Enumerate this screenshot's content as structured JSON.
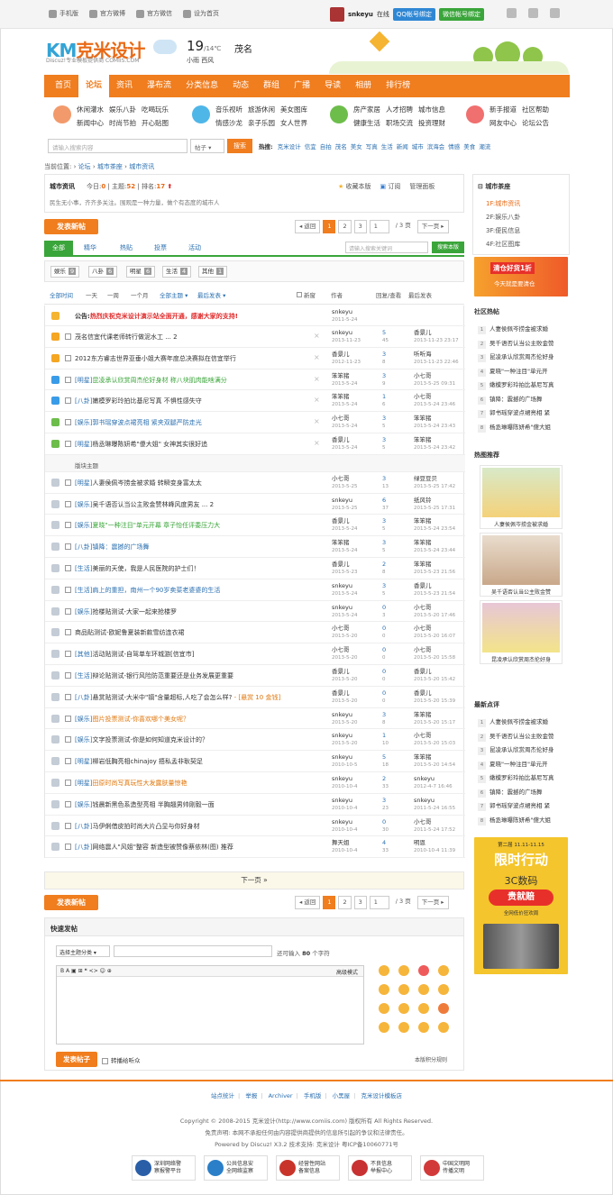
{
  "topbar": {
    "links": [
      "手机版",
      "官方微博",
      "官方微信",
      "设为首页"
    ],
    "username": "snkeyu",
    "status": "在线",
    "qq_bind": "QQ帐号绑定",
    "wx_bind": "微信帐号绑定"
  },
  "header": {
    "logo_text": "克米设计",
    "logo_prefix": "KM",
    "logo_sub": "Discuz!专业模板提供商",
    "logo_domain": "COMIIS.COM",
    "temp": "19",
    "temp_range": "/14℃",
    "city": "茂名",
    "weather_desc": "小雨 西风"
  },
  "nav": [
    "首页",
    "论坛",
    "资讯",
    "瀑布流",
    "分类信息",
    "动态",
    "群组",
    "广播",
    "导读",
    "相册",
    "排行榜"
  ],
  "nav_active": "论坛",
  "quick": [
    {
      "links": [
        "休闲灌水",
        "娱乐八卦",
        "吃喝玩乐",
        "新闻中心",
        "时尚节拍",
        "开心贴图"
      ],
      "color": "#f29a6b"
    },
    {
      "links": [
        "音乐视听",
        "旅游休闲",
        "美女图库",
        "情感沙龙",
        "亲子乐园",
        "女人世界"
      ],
      "color": "#4fb6e8"
    },
    {
      "links": [
        "房产家居",
        "人才招聘",
        "城市信息",
        "健康生活",
        "职场交流",
        "投资理财"
      ],
      "color": "#6dbd4b"
    },
    {
      "links": [
        "新手报道",
        "社区帮助",
        "网友中心",
        "论坛公告"
      ],
      "color": "#f06f6f"
    }
  ],
  "search": {
    "placeholder": "请输入搜索内容",
    "type": "帖子",
    "button": "搜索",
    "hot_label": "热搜:",
    "hot": [
      "克米设计",
      "信宜",
      "自拍",
      "茂名",
      "美女",
      "写真",
      "生活",
      "新闻",
      "城市",
      "滨海会",
      "情感",
      "美食",
      "潮流"
    ]
  },
  "breadcrumb": {
    "prefix": "当前位置:",
    "items": [
      "论坛",
      "城市茶座",
      "城市资讯"
    ],
    "sep": "›"
  },
  "forum": {
    "name": "城市资讯",
    "today_label": "今日:",
    "today": "0",
    "topics_label": "主题:",
    "topics": "52",
    "rank_label": "排名:",
    "rank": "17",
    "desc": "民生无小事，齐齐多关注。围观是一种力量，做个有态度的城市人",
    "fav": "收藏本版",
    "sub": "订阅",
    "manage": "管理面板"
  },
  "post_button": "发表新帖",
  "pager": {
    "back": "返回",
    "pages": [
      "1",
      "2",
      "3"
    ],
    "current": "1",
    "total": "/ 3 页",
    "next": "下一页"
  },
  "tabs": [
    "全部",
    "精华",
    "热贴",
    "投票",
    "活动"
  ],
  "tab_search": {
    "placeholder": "请输入搜索关键词",
    "button": "搜索本版"
  },
  "types": [
    {
      "name": "娱乐",
      "count": "9"
    },
    {
      "name": "八卦",
      "count": "6"
    },
    {
      "name": "明星",
      "count": "6"
    },
    {
      "name": "生活",
      "count": "4"
    },
    {
      "name": "其他",
      "count": "1"
    }
  ],
  "filter": {
    "items": [
      "全部时间",
      "一天",
      "一周",
      "一个月",
      "全部主题",
      "最后发表"
    ],
    "newwin": "新窗",
    "author": "作者",
    "replies": "回复/查看",
    "last": "最后发表"
  },
  "announcement": {
    "label": "公告:",
    "text": "热烈庆祝克米设计演示站全面开通，感谢大家的支持!",
    "author": "snkeyu",
    "date": "2011-5-24"
  },
  "sticky": [
    {
      "type": "",
      "title": "茂名信宜代课老师转行做泥水工",
      "suffix": " ... 2",
      "style": "",
      "author": "snkeyu",
      "date": "2013-11-23",
      "r": "5",
      "v": "45",
      "lu": "香景儿",
      "ld": "2013-11-23 23:17"
    },
    {
      "type": "",
      "title": "2012东方睿志世界亚垂小姐大赛年度总决赛拟在信宜举行",
      "suffix": "",
      "style": "",
      "author": "香景儿",
      "date": "2012-11-23",
      "r": "3",
      "v": "8",
      "lu": "听听海",
      "ld": "2013-11-23 22:46"
    },
    {
      "type": "[明星]",
      "title": "昆凌承认欣赏周杰伦好身材 称八块肌肉能啥满分",
      "suffix": "",
      "style": "green",
      "author": "笨笨猪",
      "date": "2013-5-24",
      "r": "3",
      "v": "9",
      "lu": "小七哥",
      "ld": "2013-5-25 09:31"
    },
    {
      "type": "[八卦]",
      "title": "嫩模罗彩玲拍比基尼写真 不惧性感失守",
      "suffix": "",
      "style": "",
      "author": "笨笨猪",
      "date": "2013-5-24",
      "r": "1",
      "v": "6",
      "lu": "小七哥",
      "ld": "2013-5-24 23:46"
    },
    {
      "type": "[娱乐]",
      "title": "郭书瑶穿波点裙亮相 紧夹双腿严防走光",
      "suffix": "",
      "style": "blue",
      "author": "小七哥",
      "date": "2013-5-24",
      "r": "3",
      "v": "5",
      "lu": "笨笨猪",
      "ld": "2013-5-24 23:43"
    },
    {
      "type": "[明星]",
      "title": "杨丞琳曝陈妍希\"傻大姐\" 女神其实很好追",
      "suffix": "",
      "style": "",
      "author": "香景儿",
      "date": "2013-5-24",
      "r": "3",
      "v": "5",
      "lu": "笨笨猪",
      "ld": "2013-5-24 23:42"
    }
  ],
  "section_label": "版块主题",
  "threads": [
    {
      "type": "[明星]",
      "title": "人妻侯佩岑捞金被求婚 转瞬变身富太太",
      "suffix": "",
      "style": "",
      "author": "小七哥",
      "date": "2013-5-25",
      "r": "3",
      "v": "13",
      "lu": "绿豆豆贝",
      "ld": "2013-5-25 17:42"
    },
    {
      "type": "[娱乐]",
      "title": "吴千语否认当公主败金赞林峰风度男友",
      "suffix": " ... 2",
      "style": "",
      "author": "snkeyu",
      "date": "2013-5-25",
      "r": "6",
      "v": "37",
      "lu": "纸风铃",
      "ld": "2013-5-25 17:31"
    },
    {
      "type": "[娱乐]",
      "title": "夏晓\"一种注目\"单元开幕 章子怡任评委压力大",
      "suffix": "",
      "style": "green",
      "author": "香景儿",
      "date": "2013-5-24",
      "r": "3",
      "v": "5",
      "lu": "笨笨猪",
      "ld": "2013-5-24 23:54"
    },
    {
      "type": "[八卦]",
      "title": "镇降：震撼的广场舞",
      "suffix": "",
      "style": "blue",
      "author": "笨笨猪",
      "date": "2013-5-24",
      "r": "3",
      "v": "5",
      "lu": "笨笨猪",
      "ld": "2013-5-24 23:44"
    },
    {
      "type": "[生活]",
      "title": "美丽的天使，我是人民医院的护士们！",
      "suffix": "",
      "style": "",
      "author": "香景儿",
      "date": "2013-5-23",
      "r": "2",
      "v": "8",
      "lu": "笨笨猪",
      "ld": "2013-5-23 21:56"
    },
    {
      "type": "[生活]",
      "title": "肩上的重担，南州一个90岁卖菜老婆婆的生活",
      "suffix": "",
      "style": "blue",
      "author": "snkeyu",
      "date": "2013-5-24",
      "r": "3",
      "v": "5",
      "lu": "香景儿",
      "ld": "2013-5-23 21:54"
    },
    {
      "type": "[娱乐]",
      "title": "抢楼贴测试-大家一起来抢楼罗",
      "suffix": "",
      "style": "",
      "author": "snkeyu",
      "date": "2013-5-24",
      "r": "0",
      "v": "3",
      "lu": "小七哥",
      "ld": "2013-5-20 17:46"
    },
    {
      "type": "",
      "title": "商品贴测试-欧妮鲁夏装新款雪纺连衣裙",
      "suffix": "",
      "style": "",
      "author": "小七哥",
      "date": "2013-5-20",
      "r": "0",
      "v": "0",
      "lu": "小七哥",
      "ld": "2013-5-20 16:07"
    },
    {
      "type": "[其他]",
      "title": "活动贴测试-自驾单车环城游[信宜市]",
      "suffix": "",
      "style": "",
      "author": "小七哥",
      "date": "2013-5-20",
      "r": "0",
      "v": "0",
      "lu": "小七哥",
      "ld": "2013-5-20 15:58"
    },
    {
      "type": "[生活]",
      "title": "辩论贴测试-银行风险防范重要还是业务发展更重要",
      "suffix": "",
      "style": "",
      "author": "香景儿",
      "date": "2013-5-20",
      "r": "0",
      "v": "0",
      "lu": "香景儿",
      "ld": "2013-5-20 15:42"
    },
    {
      "type": "[八卦]",
      "title": "悬赏贴测试-大米中\"镉\"含量超标,人吃了会怎么样?",
      "suffix": " - [悬赏 10 金钱]",
      "style": "",
      "author": "香景儿",
      "date": "2013-5-20",
      "r": "0",
      "v": "0",
      "lu": "香景儿",
      "ld": "2013-5-20 15:39"
    },
    {
      "type": "[娱乐]",
      "title": "图片投票测试-你喜欢哪个美女呢？",
      "suffix": "",
      "style": "orange",
      "author": "snkeyu",
      "date": "2013-5-20",
      "r": "3",
      "v": "8",
      "lu": "笨笨猪",
      "ld": "2013-5-20 15:17"
    },
    {
      "type": "[娱乐]",
      "title": "文字投票测试-你是如何知道克米设计的？",
      "suffix": "",
      "style": "",
      "author": "snkeyu",
      "date": "2013-5-20",
      "r": "1",
      "v": "10",
      "lu": "小七哥",
      "ld": "2013-5-20 15:03"
    },
    {
      "type": "[明星]",
      "title": "柳岩低胸亮相chinajoy 捂私孟非耿契足",
      "suffix": "",
      "style": "",
      "author": "snkeyu",
      "date": "2010-10-5",
      "r": "5",
      "v": "18",
      "lu": "笨笨猪",
      "ld": "2013-5-20 14:54"
    },
    {
      "type": "[明星]",
      "title": "田原时尚写真玩性大发露肤量惊艳",
      "suffix": "",
      "style": "orange",
      "author": "snkeyu",
      "date": "2010-10-4",
      "r": "2",
      "v": "33",
      "lu": "snkeyu",
      "ld": "2012-4-7 16:46"
    },
    {
      "type": "[娱乐]",
      "title": "钱晨新黑色系造型亮相 半胸翘男帅刚毅一面",
      "suffix": "",
      "style": "",
      "author": "snkeyu",
      "date": "2010-10-4",
      "r": "3",
      "v": "23",
      "lu": "snkeyu",
      "ld": "2011-5-24 16:55"
    },
    {
      "type": "[八卦]",
      "title": "马伊俐借皮拍时尚大片凸显与你好身材",
      "suffix": "",
      "style": "",
      "author": "snkeyu",
      "date": "2010-10-4",
      "r": "0",
      "v": "30",
      "lu": "小七哥",
      "ld": "2011-5-24 17:52"
    },
    {
      "type": "[八卦]",
      "title": "网络震人\"风姐\"整容 新造型被赞像蔡依林(图) 推荐",
      "suffix": "",
      "style": "",
      "author": "舞天姐",
      "date": "2010-10-4",
      "r": "4",
      "v": "33",
      "lu": "明恩",
      "ld": "2010-10-4 11:39"
    }
  ],
  "next_page": "下一页 »",
  "quick_post": {
    "title": "快速发帖",
    "select": "选择主题分类",
    "count_pre": "还可输入",
    "count": "80",
    "count_post": "个字符",
    "toolbar": "B  A  ▣  ⊞  ❝  <>  ☺  ⊕",
    "advanced": "高级模式",
    "button": "发表帖子",
    "check": "转播给听众",
    "rule": "本版积分规则"
  },
  "sidebar": {
    "category": "城市茶座",
    "forums": [
      "1F:城市资讯",
      "2F:娱乐八卦",
      "3F:便民信息",
      "4F:社区图库"
    ],
    "current": "1F:城市资讯",
    "ad1_text": "清仓好货1折",
    "ad1_sub": "今天就是要清仓",
    "hot_title": "社区热帖",
    "hot": [
      "人妻侯佩岑捞金被求婚",
      "吴千语否认当公主败金赞",
      "昆凌承认欣赏周杰伦好身",
      "夏晓\"一种注目\"单元开",
      "嫩模罗彩玲拍比基尼写真",
      "镇降：震撼的广场舞",
      "郭书瑶穿波点裙亮相 紧",
      "杨丞琳曝陈妍希\"傻大姐"
    ],
    "rec_title": "热图推荐",
    "pics": [
      "人妻侯佩岑捞金被求婚",
      "吴千语否认当公主败金赞",
      "昆凌承认欣赏周杰伦好身"
    ],
    "new_title": "最新点评",
    "new": [
      "人妻侯佩岑捞金被求婚",
      "吴千语否认当公主败金赞",
      "昆凌承认欣赏周杰伦好身",
      "夏晓\"一种注目\"单元开",
      "嫩模罗彩玲拍比基尼写真",
      "镇降：震撼的广场舞",
      "郭书瑶穿波点裙亮相 紧",
      "杨丞琳曝陈妍希\"傻大姐"
    ],
    "ad2_top": "第二届 11.11-11.15",
    "ad2_title": "限时行动",
    "ad2_sub": "3C数码",
    "ad2_main": "贵就赔",
    "ad2_small": "全网低价狂欢周"
  },
  "footer": {
    "links": [
      "站点统计",
      "举报",
      "Archiver",
      "手机版",
      "小黑屋",
      "克米设计模板店"
    ],
    "copyright": "Copyright © 2008-2015 克米设计(http://www.comiis.com) 版权所有 All Rights Reserved.",
    "disclaimer": "免责声明: 本网不承担任何由内容提供商提供的信息所引起的争议和法律责任。",
    "powered": "Powered by Discuz! X3.2  技术支持: 克米设计  粤ICP备10060771号",
    "badges": [
      {
        "l1": "深圳网络警",
        "l2": "察报警平台",
        "color": "#2a5fa8"
      },
      {
        "l1": "公共信息安",
        "l2": "全网络监察",
        "color": "#2a7fc8"
      },
      {
        "l1": "经营性网站",
        "l2": "备案信息",
        "color": "#c8342a"
      },
      {
        "l1": "不良信息",
        "l2": "举报中心",
        "color": "#c83232"
      },
      {
        "l1": "中国文明网",
        "l2": "传播文明",
        "color": "#d23a3a"
      }
    ]
  }
}
